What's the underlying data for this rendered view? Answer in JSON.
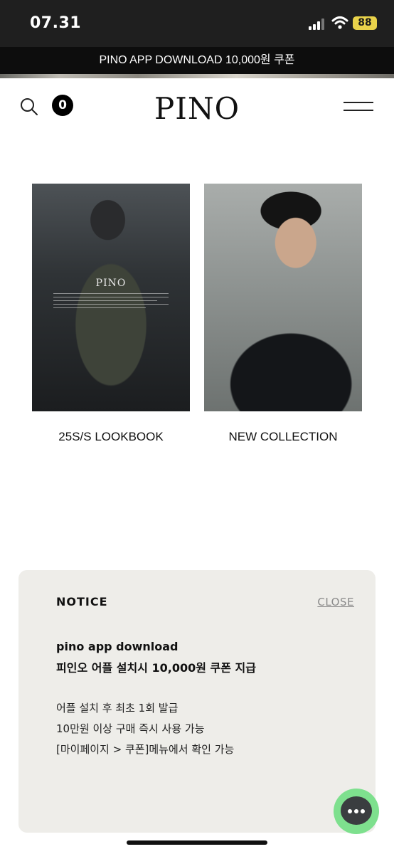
{
  "status_bar": {
    "time": "07.31",
    "battery": "88"
  },
  "promo_banner": {
    "text": "PINO APP DOWNLOAD 10,000원 쿠폰"
  },
  "header": {
    "cart_count": "0",
    "logo": "PINO"
  },
  "cards": [
    {
      "label": "25S/S LOOKBOOK",
      "image_logo": "PINO"
    },
    {
      "label": "NEW COLLECTION"
    }
  ],
  "notice": {
    "title": "NOTICE",
    "close_label": "CLOSE",
    "headline_1": "pino app download",
    "headline_2": "피인오 어플 설치시 10,000원 쿠폰 지급",
    "body_1": "어플 설치 후 최초 1회 발급",
    "body_2": "10만원 이상 구매 즉시 사용 가능",
    "body_3": "[마이페이지 > 쿠폰]메뉴에서 확인 가능"
  },
  "colors": {
    "status_bar_bg": "#1f1f1f",
    "banner_bg": "#0d0d0d",
    "battery": "#e9d24a",
    "notice_bg": "#eeede9",
    "chat_button": "#7ee08e"
  }
}
